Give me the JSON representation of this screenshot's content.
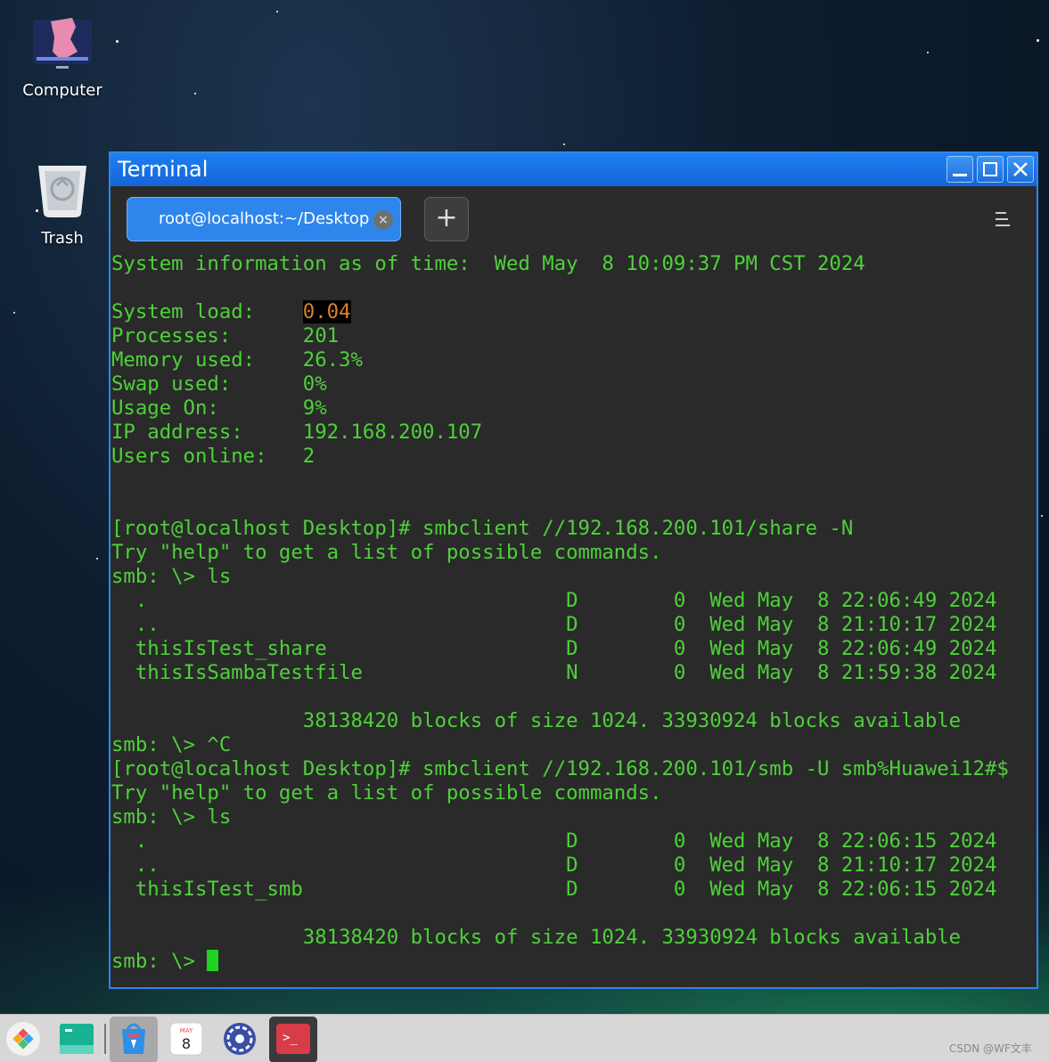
{
  "desktop": {
    "icons": [
      {
        "label": "Computer",
        "icon": "computer-icon"
      },
      {
        "label": "Trash",
        "icon": "trash-icon"
      }
    ]
  },
  "window": {
    "title": "Terminal",
    "tab_label": "root@localhost:~/Desktop",
    "tab_close_glyph": "×",
    "new_tab_glyph": "+"
  },
  "terminal": {
    "lines": [
      "System information as of time:  Wed May  8 10:09:37 PM CST 2024",
      "",
      "System load:    ",
      "Processes:      201",
      "Memory used:    26.3%",
      "Swap used:      0%",
      "Usage On:       9%",
      "IP address:     192.168.200.107",
      "Users online:   2",
      "",
      "",
      "[root@localhost Desktop]# smbclient //192.168.200.101/share -N",
      "Try \"help\" to get a list of possible commands.",
      "smb: \\> ls",
      "  .                                   D        0  Wed May  8 22:06:49 2024",
      "  ..                                  D        0  Wed May  8 21:10:17 2024",
      "  thisIsTest_share                    D        0  Wed May  8 22:06:49 2024",
      "  thisIsSambaTestfile                 N        0  Wed May  8 21:59:38 2024",
      "",
      "                38138420 blocks of size 1024. 33930924 blocks available",
      "smb: \\> ^C",
      "[root@localhost Desktop]# smbclient //192.168.200.101/smb -U smb%Huawei12#$",
      "Try \"help\" to get a list of possible commands.",
      "smb: \\> ls",
      "  .                                   D        0  Wed May  8 22:06:15 2024",
      "  ..                                  D        0  Wed May  8 21:10:17 2024",
      "  thisIsTest_smb                      D        0  Wed May  8 22:06:15 2024",
      "",
      "                38138420 blocks of size 1024. 33930924 blocks available",
      "smb: \\> "
    ],
    "system_load_value": "0.04",
    "text_color": "#4ed13a",
    "highlight_color": "#d9822b"
  },
  "taskbar": {
    "items": [
      "app-launcher-icon",
      "file-manager-icon",
      "software-store-icon",
      "calendar-icon",
      "settings-icon",
      "terminal-icon"
    ],
    "calendar_month": "MAY",
    "calendar_day": "8",
    "terminal_glyph": ">_",
    "watermark": "CSDN @WF文丰"
  },
  "colors": {
    "titlebar": "#1c7ff2",
    "tab_active": "#2e86ed",
    "terminal_bg": "#2a2a2a"
  }
}
